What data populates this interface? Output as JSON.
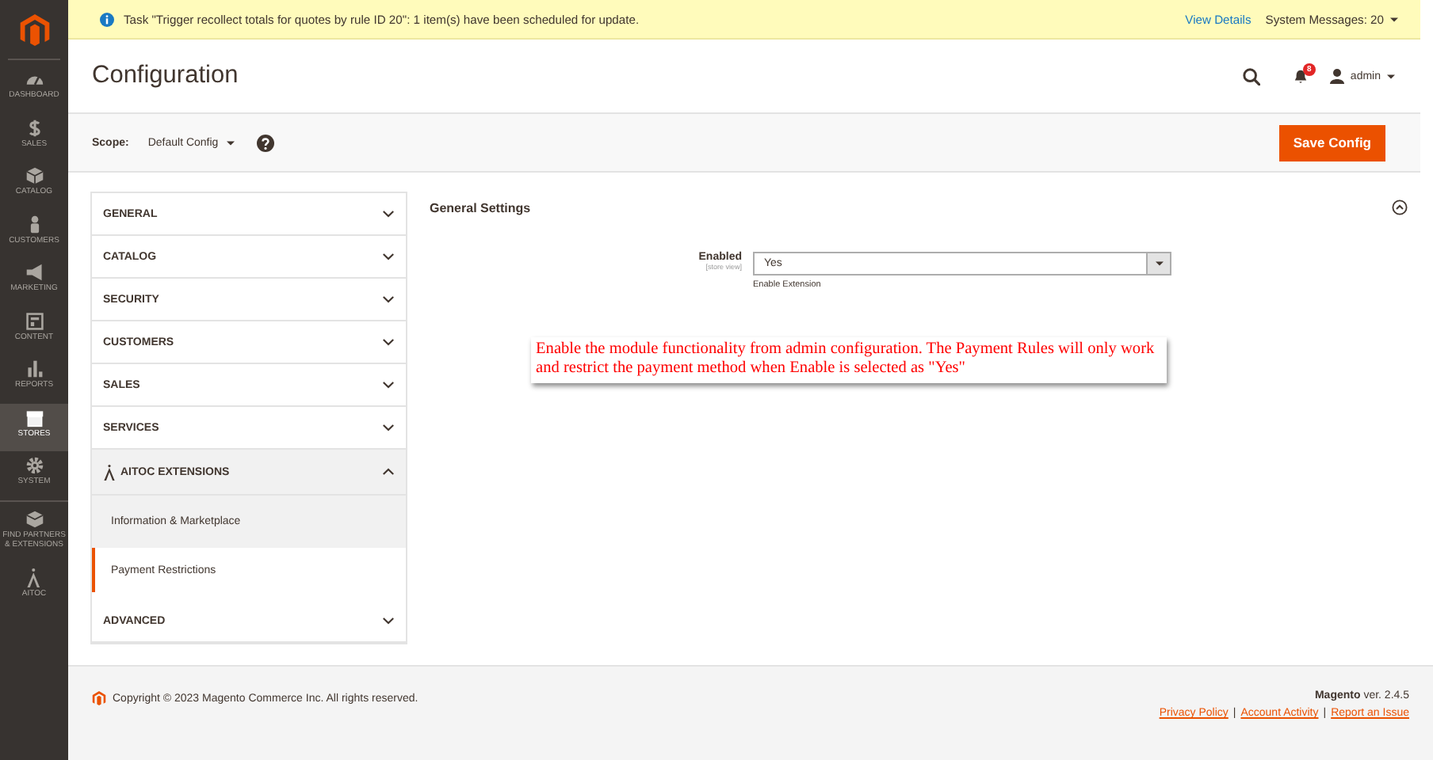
{
  "sidebar": {
    "items": [
      {
        "label": "DASHBOARD",
        "selected": false
      },
      {
        "label": "SALES",
        "selected": false
      },
      {
        "label": "CATALOG",
        "selected": false
      },
      {
        "label": "CUSTOMERS",
        "selected": false
      },
      {
        "label": "MARKETING",
        "selected": false
      },
      {
        "label": "CONTENT",
        "selected": false
      },
      {
        "label": "REPORTS",
        "selected": false
      },
      {
        "label": "STORES",
        "selected": true
      },
      {
        "label": "SYSTEM",
        "selected": false
      },
      {
        "label": "FIND PARTNERS & EXTENSIONS",
        "selected": false
      },
      {
        "label": "AITOC",
        "selected": false
      }
    ]
  },
  "message_bar": {
    "text": "Task \"Trigger recollect totals for quotes by rule ID 20\": 1 item(s) have been scheduled for update.",
    "link": "View Details",
    "system_messages": "System Messages: 20"
  },
  "header": {
    "title": "Configuration",
    "notifications": "8",
    "user": "admin"
  },
  "actions": {
    "scope_label": "Scope:",
    "scope_value": "Default Config",
    "save_button": "Save Config"
  },
  "config_tabs": [
    {
      "label": "GENERAL",
      "kind": "section",
      "expanded": false
    },
    {
      "label": "CATALOG",
      "kind": "section",
      "expanded": false
    },
    {
      "label": "SECURITY",
      "kind": "section",
      "expanded": false
    },
    {
      "label": "CUSTOMERS",
      "kind": "section",
      "expanded": false
    },
    {
      "label": "SALES",
      "kind": "section",
      "expanded": false
    },
    {
      "label": "SERVICES",
      "kind": "section",
      "expanded": false
    },
    {
      "label": "AITOC EXTENSIONS",
      "kind": "vendor",
      "expanded": true,
      "children": [
        {
          "label": "Information & Marketplace",
          "selected": false
        },
        {
          "label": "Payment Restrictions",
          "selected": true
        }
      ]
    },
    {
      "label": "ADVANCED",
      "kind": "section",
      "expanded": false
    }
  ],
  "settings": {
    "title": "General Settings",
    "expanded": true,
    "field": {
      "label": "Enabled",
      "scope": "[store view]",
      "value": "Yes",
      "comment": "Enable Extension"
    },
    "annotation": "Enable the module functionality from admin configuration. The Payment Rules will only work and restrict the payment method when Enable is selected as \"Yes\""
  },
  "footer": {
    "copyright": "Copyright © 2023 Magento Commerce Inc. All rights reserved.",
    "version": "**Magento** ver. 2.4.5",
    "links": [
      "Privacy Policy",
      "Account Activity",
      "Report an Issue"
    ],
    "separator": "|"
  }
}
